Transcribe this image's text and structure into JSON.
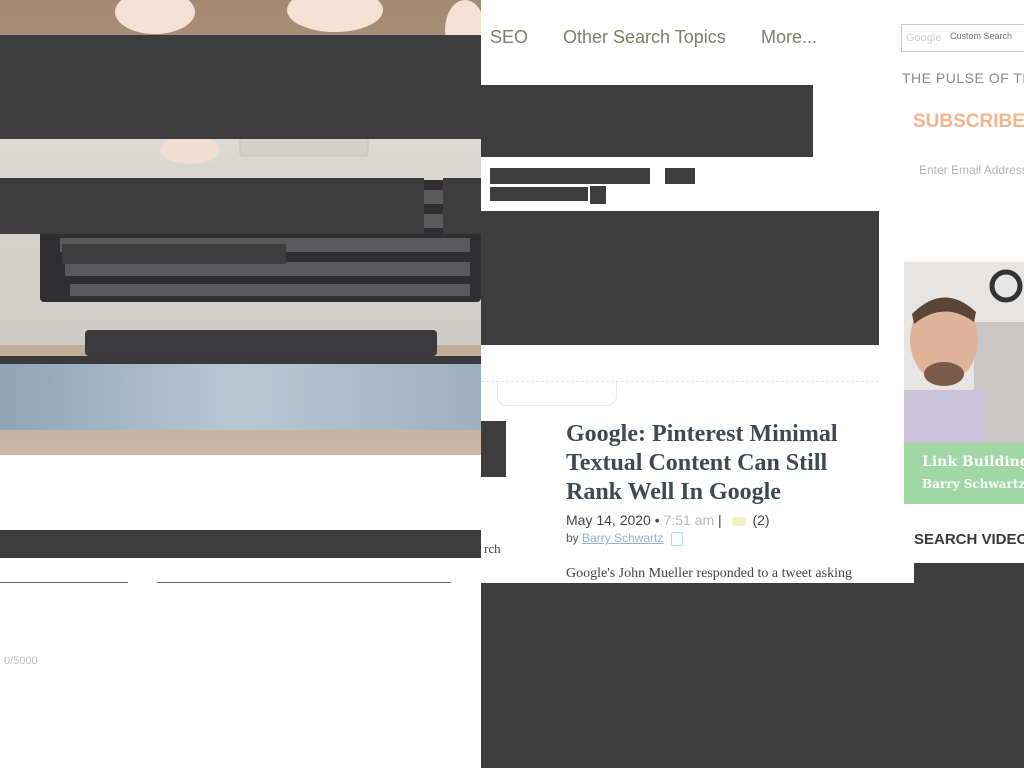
{
  "nav": {
    "items": [
      "SEO",
      "Other Search Topics",
      "More..."
    ]
  },
  "search": {
    "brand_mark": "Google",
    "placeholder": "Custom Search"
  },
  "sidebar": {
    "tagline": "THE PULSE OF TH",
    "subscribe_label": "SUBSCRIBE",
    "email_placeholder": "Enter Email Address",
    "ad": {
      "line1": "Link Building",
      "line2": "Barry Schwartz"
    },
    "search_videos_heading": "SEARCH VIDEO"
  },
  "article": {
    "title": "Google: Pinterest Minimal Textual Content Can Still Rank Well In Google",
    "date": "May 14, 2020",
    "separator": "•",
    "time": "7:51 am",
    "pipe": "|",
    "comments": "(2)",
    "by_label": "by",
    "author": "Barry Schwartz",
    "excerpt": "Google's John Mueller responded to a tweet asking"
  },
  "left_panel": {
    "fragment_text": "rch",
    "char_counter": "0/5000"
  },
  "colors": {
    "nav_text": "#7d7f65",
    "subscribe_accent": "#f2b48c",
    "ad_green": "#9fd8a4",
    "overlay_block": "#3d3d3d"
  }
}
